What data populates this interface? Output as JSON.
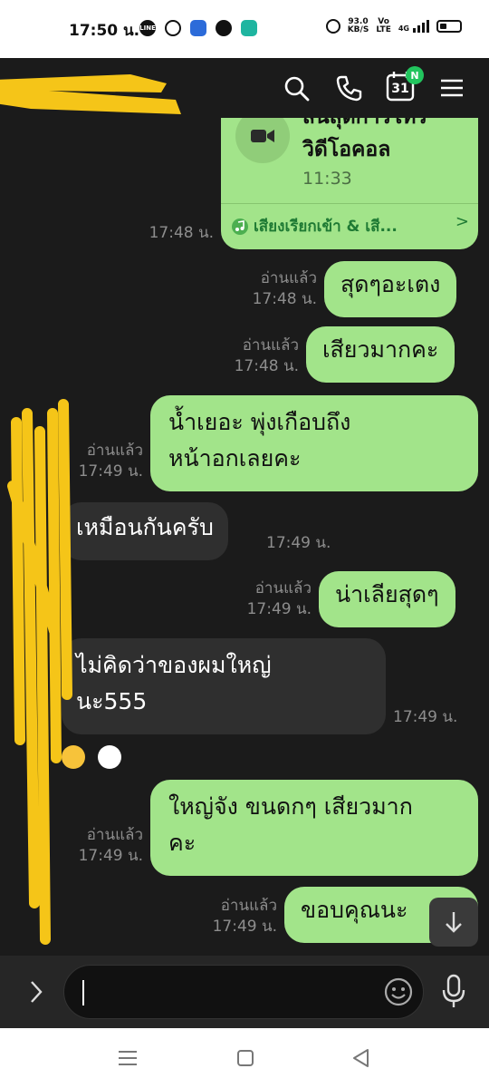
{
  "status_bar": {
    "time": "17:50 น.",
    "network_speed_value": "93.0",
    "network_speed_unit": "KB/S",
    "volte_top": "Vo",
    "volte_bottom": "LTE",
    "signal_label": "4G",
    "app_icons": [
      "line-icon",
      "chat-bubble-icon",
      "blue-app-icon",
      "profile-icon",
      "teal-app-icon"
    ]
  },
  "header": {
    "calendar_day": "31",
    "calendar_badge": "N",
    "icons": [
      "search-icon",
      "phone-icon",
      "calendar-icon",
      "menu-icon"
    ]
  },
  "call_card": {
    "title_line1": "สิ้นสุดการโทร",
    "title_line2": "วิดีโอคอล",
    "duration": "11:33",
    "link_text": "เสียงเรียกเข้า & เสี...",
    "sent_time": "17:48 น."
  },
  "messages": [
    {
      "direction": "out",
      "text": "สุดๆอะเตง",
      "read": "อ่านแล้ว",
      "time": "17:48 น."
    },
    {
      "direction": "out",
      "text": "เสียวมากคะ",
      "read": "อ่านแล้ว",
      "time": "17:48 น."
    },
    {
      "direction": "out",
      "text_line1": "น้ำเยอะ พุ่งเกือบถึง",
      "text_line2": "หน้าอกเลยคะ",
      "read": "อ่านแล้ว",
      "time": "17:49 น."
    },
    {
      "direction": "in",
      "text": "เหมือนกันครับ",
      "time": "17:49 น."
    },
    {
      "direction": "out",
      "text": "น่าเลียสุดๆ",
      "read": "อ่านแล้ว",
      "time": "17:49 น."
    },
    {
      "direction": "in",
      "text_line1": "ไม่คิดว่าของผมใหญ่",
      "text_line2": "นะ555",
      "time": "17:49 น."
    },
    {
      "direction": "out",
      "text_line1": "ใหญ่จัง ขนดกๆ เสียวมาก",
      "text_line2": "คะ",
      "read": "อ่านแล้ว",
      "time": "17:49 น."
    },
    {
      "direction": "out",
      "text": "ขอบคุณนะ",
      "read": "อ่านแล้ว",
      "time": "17:49 น."
    }
  ],
  "reactions": [
    "smile-emoji",
    "thinking-emoji"
  ],
  "input": {
    "placeholder": "",
    "value": ""
  },
  "colors": {
    "outgoing_bubble": "#a2e48a",
    "incoming_bubble": "#2f2f2f",
    "chat_background": "#1b1b1b",
    "scribble": "#f5c518"
  }
}
